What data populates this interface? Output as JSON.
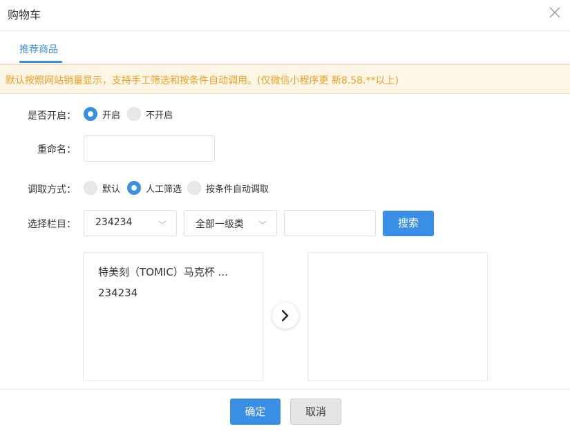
{
  "dialog": {
    "title": "购物车",
    "close_icon": "close-icon"
  },
  "tabs": [
    {
      "label": "推荐商品",
      "active": true
    }
  ],
  "notice": {
    "text": "默认按照网站销量显示，支持手工筛选和按条件自动调用。(仅微信小程序更 新8.58.**以上)",
    "color": "#f0a020"
  },
  "form": {
    "enable": {
      "label": "是否开启：",
      "options": [
        {
          "label": "开启",
          "checked": true
        },
        {
          "label": "不开启",
          "checked": false
        }
      ]
    },
    "rename": {
      "label": "重命名：",
      "value": "",
      "placeholder": ""
    },
    "fetch_mode": {
      "label": "调取方式：",
      "options": [
        {
          "label": "默认",
          "checked": false
        },
        {
          "label": "人工筛选",
          "checked": true
        },
        {
          "label": "按条件自动调取",
          "checked": false
        }
      ]
    },
    "column": {
      "label": "选择栏目：",
      "select1_value": "234234",
      "select2_value": "全部一级类",
      "search_value": "",
      "search_button": "搜索"
    }
  },
  "source_list": {
    "items": [
      {
        "label": "特美刻（TOMIC）马克杯 ..."
      },
      {
        "label": "234234"
      }
    ]
  },
  "target_list": {
    "items": []
  },
  "transfer_icon": "chevron-right-icon",
  "footer": {
    "confirm_label": "确定",
    "cancel_label": "取消"
  },
  "colors": {
    "primary": "#3a8ee6",
    "notice_bg": "#fdf6e7",
    "notice_text": "#f0a020"
  }
}
